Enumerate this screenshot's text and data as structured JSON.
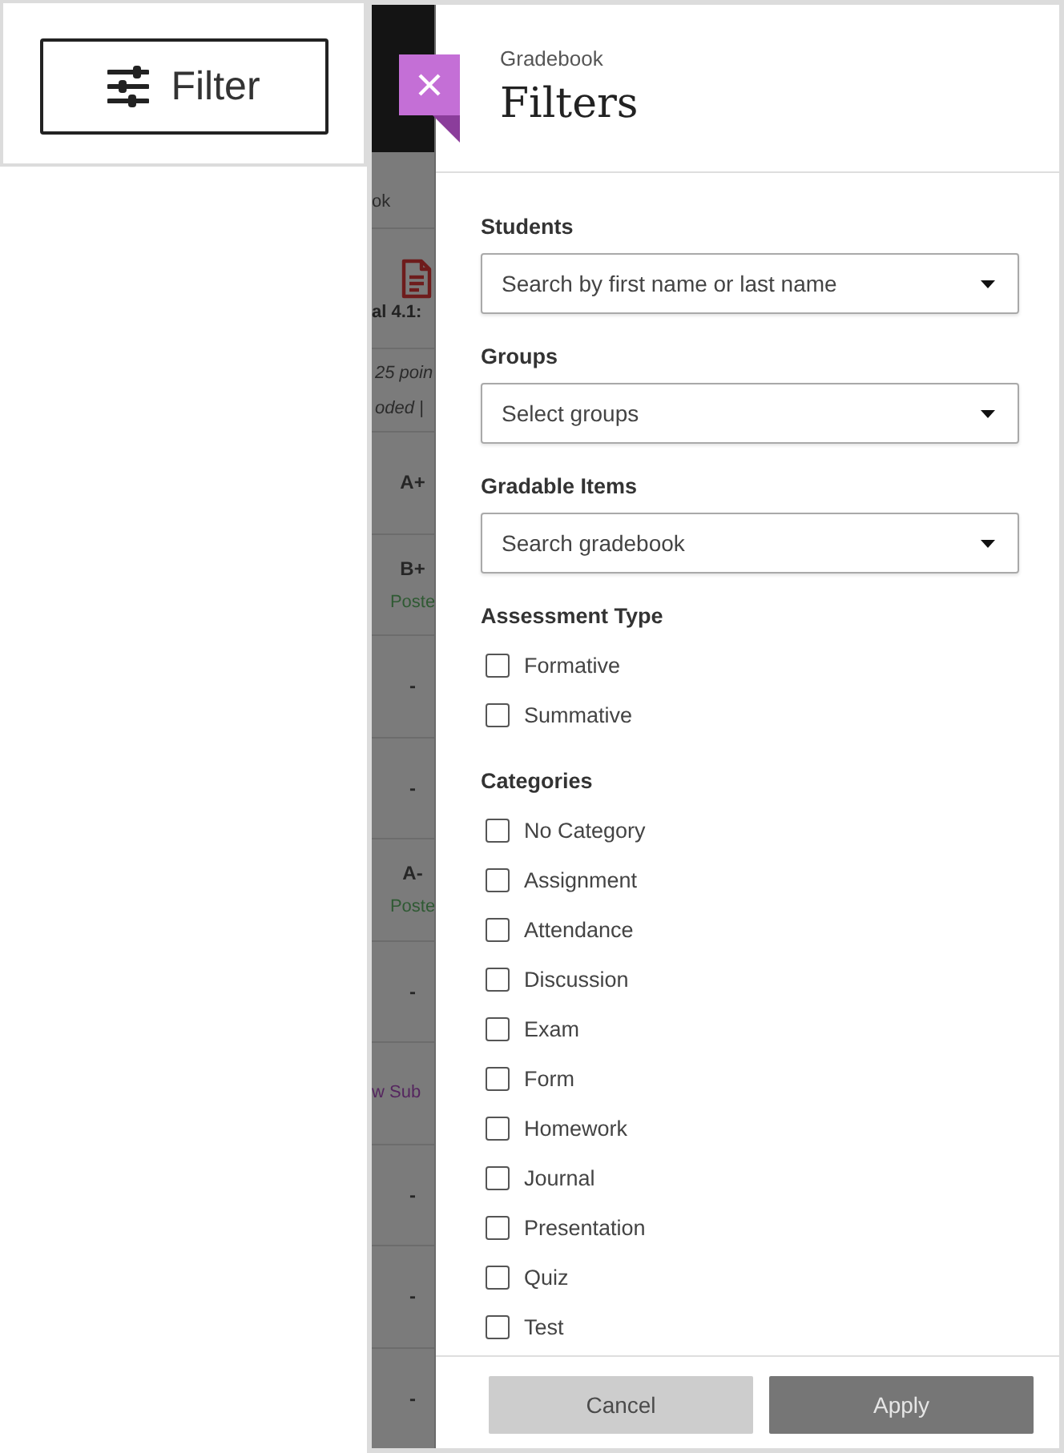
{
  "filter_button": {
    "label": "Filter"
  },
  "backdrop": {
    "column_heading": "ok",
    "item_title": "al 4.1:",
    "points": "25 poin",
    "status": "oded |",
    "rows": [
      {
        "kind": "grade",
        "text": "A+"
      },
      {
        "kind": "grade",
        "text": "B+",
        "status": "Poste"
      },
      {
        "kind": "grade",
        "text": "-"
      },
      {
        "kind": "grade",
        "text": "-"
      },
      {
        "kind": "grade",
        "text": "A-",
        "status": "Poste"
      },
      {
        "kind": "grade",
        "text": "-"
      },
      {
        "kind": "link",
        "text": "w Sub"
      },
      {
        "kind": "grade",
        "text": "-"
      },
      {
        "kind": "grade",
        "text": "-"
      },
      {
        "kind": "grade",
        "text": "-"
      }
    ]
  },
  "panel": {
    "breadcrumb": "Gradebook",
    "title": "Filters",
    "fields": [
      {
        "label": "Students",
        "placeholder": "Search by first name or last name"
      },
      {
        "label": "Groups",
        "placeholder": "Select groups"
      },
      {
        "label": "Gradable Items",
        "placeholder": "Search gradebook"
      }
    ],
    "checkbox_groups": [
      {
        "label": "Assessment Type",
        "options": [
          {
            "label": "Formative",
            "checked": false
          },
          {
            "label": "Summative",
            "checked": false
          }
        ]
      },
      {
        "label": "Categories",
        "options": [
          {
            "label": "No Category",
            "checked": false
          },
          {
            "label": "Assignment",
            "checked": false
          },
          {
            "label": "Attendance",
            "checked": false
          },
          {
            "label": "Discussion",
            "checked": false
          },
          {
            "label": "Exam",
            "checked": false
          },
          {
            "label": "Form",
            "checked": false
          },
          {
            "label": "Homework",
            "checked": false
          },
          {
            "label": "Journal",
            "checked": false
          },
          {
            "label": "Presentation",
            "checked": false
          },
          {
            "label": "Quiz",
            "checked": false
          },
          {
            "label": "Test",
            "checked": false
          }
        ]
      }
    ],
    "buttons": [
      {
        "label": "Cancel",
        "kind": "secondary"
      },
      {
        "label": "Apply",
        "kind": "primary"
      }
    ]
  }
}
